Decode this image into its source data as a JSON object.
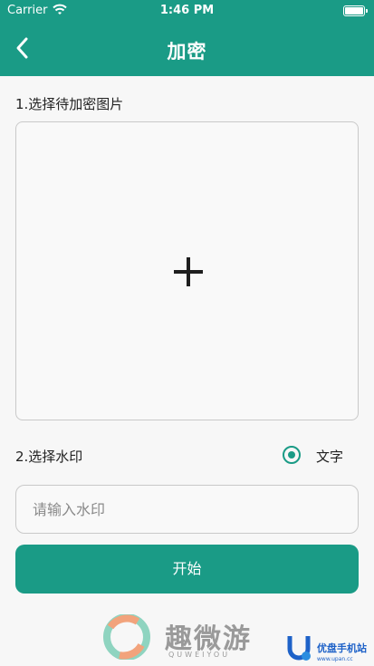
{
  "status_bar": {
    "carrier": "Carrier",
    "time": "1:46 PM",
    "battery_level": 1.0
  },
  "nav": {
    "title": "加密",
    "back_icon": "chevron-left-icon"
  },
  "image_section": {
    "label": "1.选择待加密图片",
    "add_icon": "plus-icon"
  },
  "watermark_section": {
    "label": "2.选择水印",
    "option_label": "文字",
    "option_selected": true,
    "input_value": "",
    "input_placeholder": "请输入水印"
  },
  "actions": {
    "start_label": "开始"
  },
  "overlay_watermarks": {
    "brand_text": "趣微游",
    "brand_sub": "QUWEIYOU",
    "site_text": "优盘手机站",
    "site_url": "www.upan.cc"
  },
  "colors": {
    "primary": "#1a9b86",
    "background": "#f7f7f7"
  }
}
